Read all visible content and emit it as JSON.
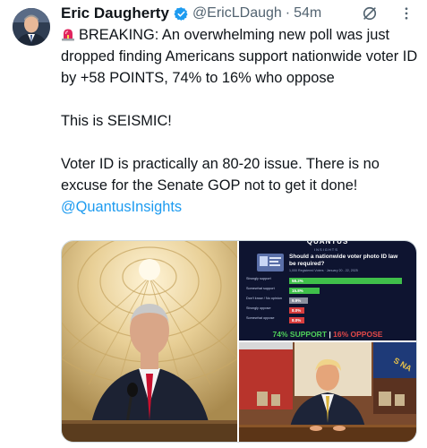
{
  "author": {
    "name": "Eric Daugherty",
    "handle": "@EricLDaugh",
    "separator": "·",
    "time": "54m"
  },
  "tweet": {
    "line1": "BREAKING: An overwhelming new poll was just dropped finding Americans support nationwide voter ID by +58 POINTS, 74% to 16% who oppose",
    "line2": "This is SEISMIC!",
    "line3_text": "Voter ID is practically an 80-20 issue. There is no excuse for the Senate GOP not to get it done!",
    "mention": "@QuantusInsights"
  },
  "poll_graphic": {
    "brand": "QUANTUS",
    "brand_sub": "INSIGHTS",
    "question": "Should a nationwide voter photo ID law be required?",
    "dates": "1,000 Registered Voters · January 20 - 22, 2025",
    "rows": [
      {
        "label": "Strongly support",
        "value": "58.2%",
        "pct": 58.2,
        "color": "#3fbf4a"
      },
      {
        "label": "Somewhat support",
        "value": "15.8%",
        "pct": 15.8,
        "color": "#3fbf4a"
      },
      {
        "label": "Don't know / No opinion",
        "value": "9.9%",
        "pct": 9.9,
        "color": "#8a8f9e"
      },
      {
        "label": "Strongly oppose",
        "value": "8.0%",
        "pct": 8.0,
        "color": "#d93d3d"
      },
      {
        "label": "Somewhat oppose",
        "value": "8.0%",
        "pct": 8.0,
        "color": "#d93d3d"
      }
    ],
    "footer_support": "74% SUPPORT",
    "footer_divider": "|",
    "footer_oppose": "16% OPPOSE"
  },
  "colors": {
    "accent": "#1d9bf0",
    "secondary_text": "#536471",
    "support_green": "#3fbf4a",
    "oppose_red": "#d93d3d",
    "poll_bg": "#0e1430"
  },
  "icons": [
    "verified-badge-icon",
    "grok-icon",
    "more-options-icon",
    "siren-icon"
  ]
}
